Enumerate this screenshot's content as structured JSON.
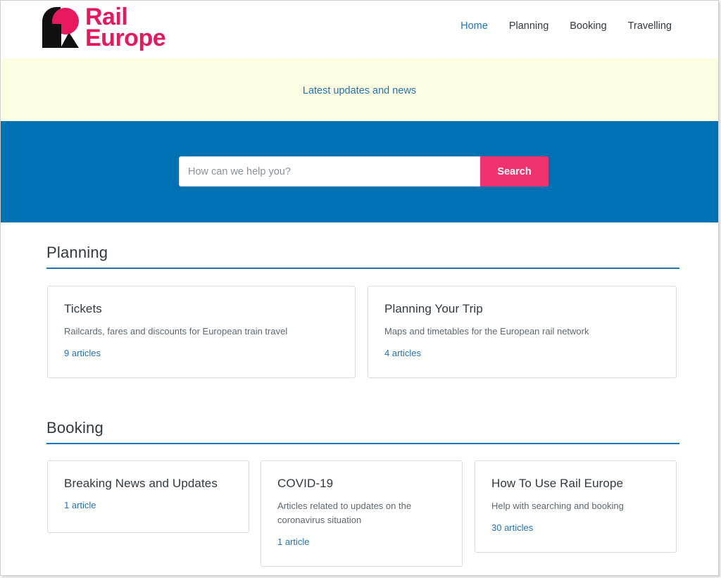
{
  "brand": {
    "name_line1": "Rail",
    "name_line2": "Europe",
    "color": "#e8185f"
  },
  "nav": {
    "items": [
      {
        "label": "Home",
        "active": true
      },
      {
        "label": "Planning",
        "active": false
      },
      {
        "label": "Booking",
        "active": false
      },
      {
        "label": "Travelling",
        "active": false
      }
    ]
  },
  "notice": {
    "text": "Latest updates and news"
  },
  "search": {
    "placeholder": "How can we help you?",
    "button_label": "Search"
  },
  "sections": {
    "planning": {
      "title": "Planning",
      "cards": [
        {
          "title": "Tickets",
          "description": "Railcards, fares and discounts for European train travel",
          "count": "9 articles"
        },
        {
          "title": "Planning Your Trip",
          "description": "Maps and timetables for the European rail network",
          "count": "4 articles"
        }
      ]
    },
    "booking": {
      "title": "Booking",
      "cards": [
        {
          "title": "Breaking News and Updates",
          "description": "",
          "count": "1 article"
        },
        {
          "title": "COVID-19",
          "description": "Articles related to updates on the coronavirus situation",
          "count": "1 article"
        },
        {
          "title": "How To Use Rail Europe",
          "description": "Help with searching and booking",
          "count": "30 articles"
        }
      ]
    }
  },
  "colors": {
    "accent_blue": "#1f73b7",
    "hero_blue": "#0072b3",
    "notice_bg": "#fdfde2",
    "search_button": "#f0336e"
  }
}
